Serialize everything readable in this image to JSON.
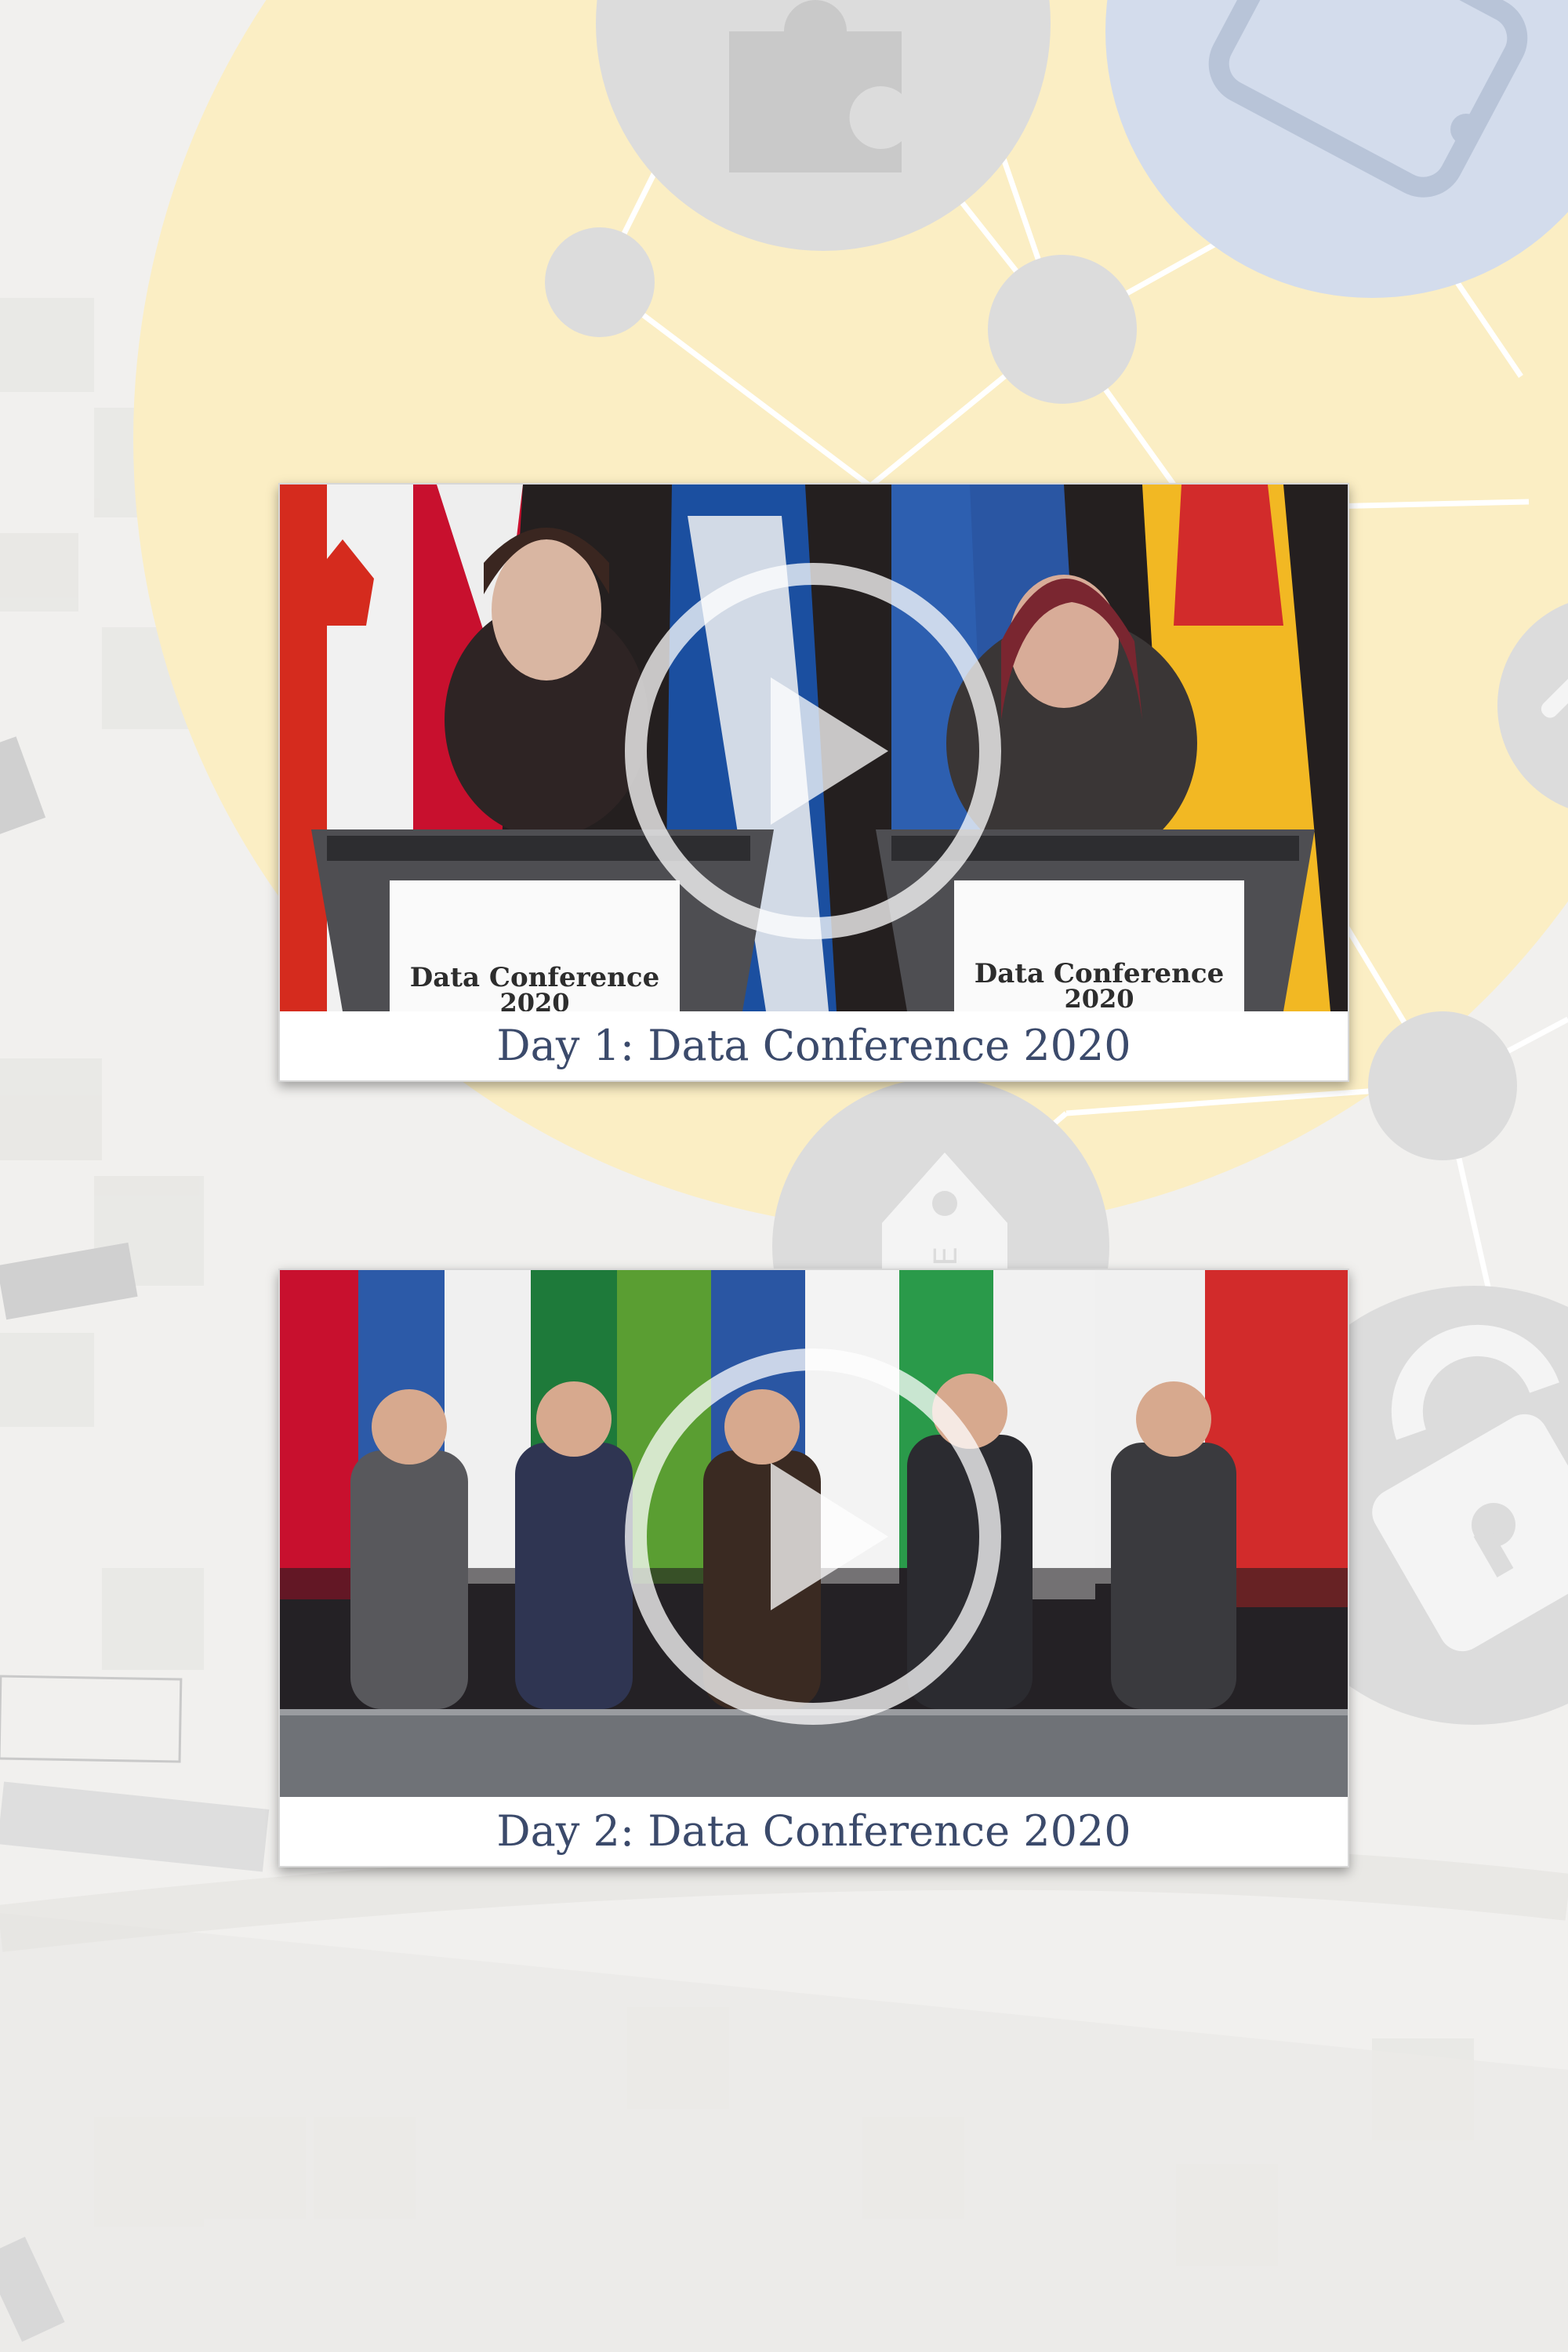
{
  "colors": {
    "background": "#f1f0ee",
    "circle_yellow": "#fbeec4",
    "node_gray": "#dcdcdc",
    "node_blue": "#d3dcec",
    "caption_text": "#3b4a6b"
  },
  "videos": [
    {
      "caption": "Day 1: Data Conference 2020",
      "podium_left": {
        "line1": "Data Conference",
        "line2": "2020"
      },
      "podium_right": {
        "line1": "Data Conference",
        "line2": "2020"
      },
      "play_icon": "play-circle-icon"
    },
    {
      "caption": "Day 2: Data Conference 2020",
      "play_icon": "play-circle-icon"
    }
  ],
  "decor_icons": [
    "puzzle-icon",
    "tablet-icon",
    "price-tag-icon",
    "padlock-icon",
    "pointer-icon"
  ]
}
